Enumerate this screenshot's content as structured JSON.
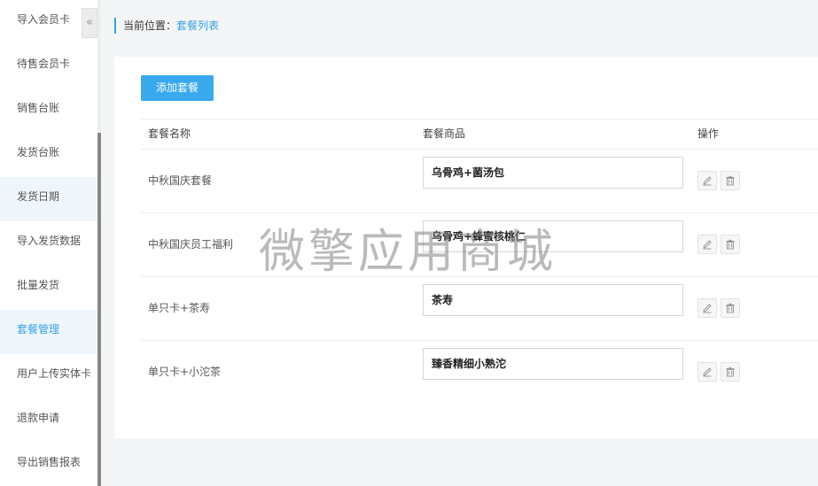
{
  "sidebar": {
    "collapse_glyph": "«",
    "items": [
      {
        "label": "导入会员卡"
      },
      {
        "label": "待售会员卡"
      },
      {
        "label": "销售台账"
      },
      {
        "label": "发货台账"
      },
      {
        "label": "发货日期"
      },
      {
        "label": "导入发货数据"
      },
      {
        "label": "批量发货"
      },
      {
        "label": "套餐管理"
      },
      {
        "label": "用户上传实体卡"
      },
      {
        "label": "退款申请"
      },
      {
        "label": "导出销售报表"
      }
    ]
  },
  "breadcrumb": {
    "prefix": "当前位置：",
    "current": "套餐列表"
  },
  "toolbar": {
    "add_label": "添加套餐"
  },
  "table": {
    "headers": [
      "套餐名称",
      "套餐商品",
      "操作"
    ],
    "rows": [
      {
        "name": "中秋国庆套餐",
        "goods": "乌骨鸡+菌汤包"
      },
      {
        "name": "中秋国庆员工福利",
        "goods": "乌骨鸡+蜂蜜核桃仁"
      },
      {
        "name": "单只卡+茶寿",
        "goods": "茶寿"
      },
      {
        "name": "单只卡+小沱茶",
        "goods": "臻香精细小熟沱"
      }
    ]
  },
  "watermark": "微擎应用商城",
  "colors": {
    "accent": "#39a9ee",
    "active_bg": "#eef6fc",
    "page_bg": "#f4f5f7"
  },
  "icons": {
    "edit": "pencil-icon",
    "delete": "trash-icon",
    "collapse": "double-chevron-left-icon"
  }
}
